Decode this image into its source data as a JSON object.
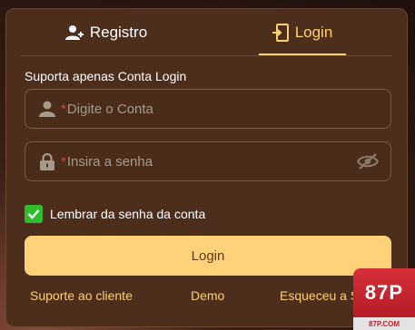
{
  "tabs": {
    "registro": {
      "label": "Registro",
      "icon": "user-plus-icon"
    },
    "login": {
      "label": "Login",
      "icon": "door-enter-icon"
    }
  },
  "form": {
    "caption": "Suporta apenas Conta Login",
    "account": {
      "required_mark": "*",
      "placeholder": "Digite o Conta",
      "value": "",
      "icon": "user-icon"
    },
    "password": {
      "required_mark": "*",
      "placeholder": "Insira a senha",
      "value": "",
      "icon": "lock-icon",
      "toggle_icon": "eye-slash-icon"
    },
    "remember": {
      "label": "Lembrar da senha da conta",
      "checked": true
    },
    "submit_label": "Login"
  },
  "footer": {
    "support": "Suporte ao cliente",
    "demo": "Demo",
    "forgot": "Esqueceu a S"
  },
  "brand": {
    "logo_text": "87P",
    "domain": "87P.COM"
  },
  "colors": {
    "panel": "#4d2e1c",
    "accent": "#ffcf6e",
    "button": "#ffd27a",
    "checkbox": "#2fbe2c",
    "required": "#e0413a"
  }
}
